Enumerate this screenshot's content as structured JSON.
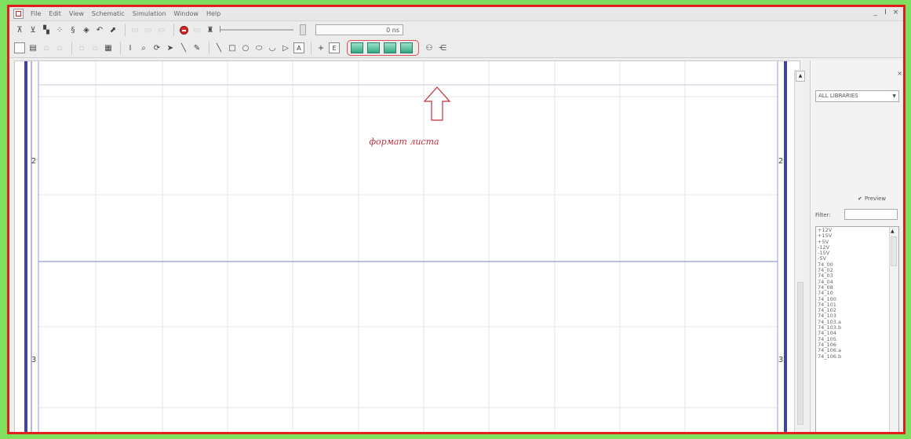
{
  "menu": {
    "items": [
      "File",
      "Edit",
      "View",
      "Schematic",
      "Simulation",
      "Window",
      "Help"
    ]
  },
  "window_controls": {
    "minimize": "_",
    "restore": "І",
    "close": "×"
  },
  "toolbar": {
    "time_value": "0 ns",
    "labels": {
      "text_tool": "A",
      "cross": "+",
      "e_tool": "E",
      "info": "I"
    }
  },
  "sheet": {
    "row_labels": [
      "2",
      "3"
    ],
    "annotation": "формат листа"
  },
  "library_panel": {
    "close": "×",
    "library_select": "ALL LIBRARIES",
    "preview_label": "Preview",
    "preview_checked": true,
    "filter_label": "Filter:",
    "filter_value": "",
    "components": [
      "+12V",
      "+15V",
      "+5V",
      "-12V",
      "-15V",
      "-5V",
      "74_00",
      "74_02",
      "74_03",
      "74_04",
      "74_08",
      "74_10",
      "74_100",
      "74_101",
      "74_102",
      "74_103",
      "74_103.a",
      "74_103.b",
      "74_104",
      "74_105",
      "74_106",
      "74_106.a",
      "74_106.b"
    ]
  }
}
